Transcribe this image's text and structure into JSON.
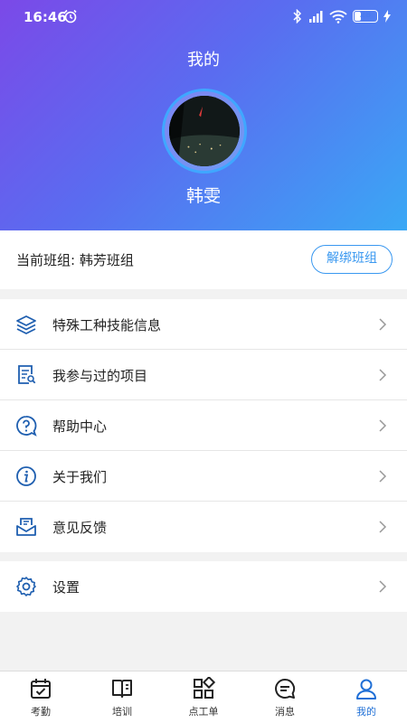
{
  "status_bar": {
    "time": "16:46",
    "battery": "28",
    "battery_level": 0.28
  },
  "header": {
    "title": "我的",
    "user_name": "韩雯"
  },
  "group": {
    "label": "当前班组: 韩芳班组",
    "unbind_button": "解绑班组"
  },
  "menu_group_1": [
    {
      "label": "特殊工种技能信息",
      "icon": "layers-icon"
    },
    {
      "label": "我参与过的项目",
      "icon": "document-search-icon"
    },
    {
      "label": "帮助中心",
      "icon": "help-icon"
    },
    {
      "label": "关于我们",
      "icon": "info-icon"
    },
    {
      "label": "意见反馈",
      "icon": "feedback-icon"
    }
  ],
  "menu_group_2": [
    {
      "label": "设置",
      "icon": "gear-icon"
    }
  ],
  "tabbar": [
    {
      "label": "考勤",
      "icon": "calendar-check-icon"
    },
    {
      "label": "培训",
      "icon": "book-icon"
    },
    {
      "label": "点工单",
      "icon": "grid-icon"
    },
    {
      "label": "消息",
      "icon": "chat-icon"
    },
    {
      "label": "我的",
      "icon": "user-icon",
      "active": true
    }
  ],
  "colors": {
    "accent": "#1f6fd6",
    "header_start": "#7b49e8",
    "header_end": "#3aa8f5",
    "button_border": "#3a98f0"
  }
}
